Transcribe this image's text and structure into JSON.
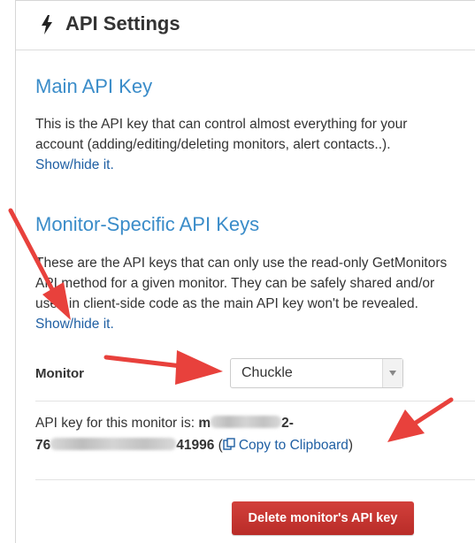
{
  "panel": {
    "title": "API Settings",
    "icon": "bolt-icon"
  },
  "main_key": {
    "heading": "Main API Key",
    "description_1": "This is the API key that can control almost everything for your",
    "description_2": "account (adding/editing/deleting monitors, alert contacts..).",
    "toggle_link": "Show/hide it."
  },
  "monitor_keys": {
    "heading": "Monitor-Specific API Keys",
    "description_1": "These are the API keys that can only use the read-only GetMonitors",
    "description_2": "API method for a given monitor. They can be safely shared and/or",
    "description_3": "used in client-side code as the main API key won't be revealed.",
    "toggle_link": "Show/hide it."
  },
  "monitor_select": {
    "label": "Monitor",
    "selected": "Chuckle"
  },
  "api_key_info": {
    "prefix": "API key for this monitor is:",
    "key_start": "m",
    "key_mid": "2-",
    "key_line2_start": "76",
    "key_line2_end": "41996",
    "open_paren": "(",
    "copy_link": "Copy to Clipboard",
    "close_paren": ")"
  },
  "actions": {
    "delete_label": "Delete monitor's API key"
  },
  "colors": {
    "accent": "#3a8cc9",
    "link": "#1f5fa3",
    "danger": "#c9302c",
    "annotation_arrow": "#e8413c"
  }
}
